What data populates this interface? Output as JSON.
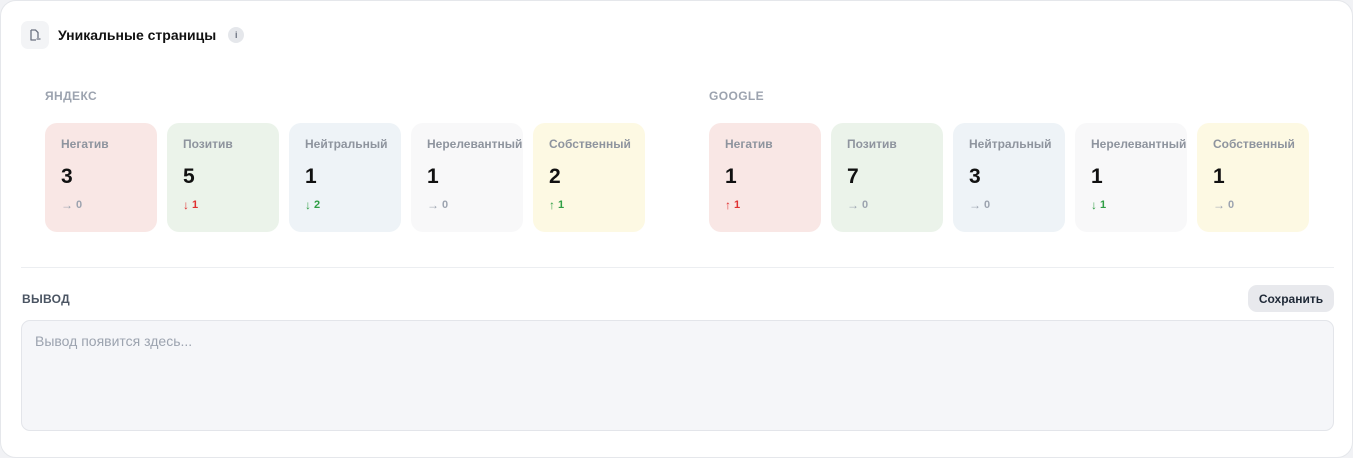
{
  "header": {
    "title": "Уникальные страницы",
    "info_icon": "i",
    "icon": "page-search-icon"
  },
  "colors": {
    "negative_bg": "#f9e7e5",
    "positive_bg": "#ebf3ea",
    "neutral_bg": "#eef3f7",
    "irrelevant_bg": "#f8f8f9",
    "own_bg": "#fdf9e3",
    "delta_up": "#2f9e44",
    "delta_down": "#e03131",
    "delta_neutral": "#9ca3af"
  },
  "engines": [
    {
      "label": "ЯНДЕКС",
      "cards": [
        {
          "label": "Негатив",
          "value": "3",
          "arrow": "→",
          "delta": "0",
          "tone": "neutral",
          "bg": "negative"
        },
        {
          "label": "Позитив",
          "value": "5",
          "arrow": "↓",
          "delta": "1",
          "tone": "down",
          "bg": "positive"
        },
        {
          "label": "Нейтральный",
          "value": "1",
          "arrow": "↓",
          "delta": "2",
          "tone": "up",
          "bg": "neutral"
        },
        {
          "label": "Нерелевантный",
          "value": "1",
          "arrow": "→",
          "delta": "0",
          "tone": "neutral",
          "bg": "irrelevant"
        },
        {
          "label": "Собственный",
          "value": "2",
          "arrow": "↑",
          "delta": "1",
          "tone": "up",
          "bg": "own"
        }
      ]
    },
    {
      "label": "GOOGLE",
      "cards": [
        {
          "label": "Негатив",
          "value": "1",
          "arrow": "↑",
          "delta": "1",
          "tone": "down",
          "bg": "negative"
        },
        {
          "label": "Позитив",
          "value": "7",
          "arrow": "→",
          "delta": "0",
          "tone": "neutral",
          "bg": "positive"
        },
        {
          "label": "Нейтральный",
          "value": "3",
          "arrow": "→",
          "delta": "0",
          "tone": "neutral",
          "bg": "neutral"
        },
        {
          "label": "Нерелевантный",
          "value": "1",
          "arrow": "↓",
          "delta": "1",
          "tone": "up",
          "bg": "irrelevant"
        },
        {
          "label": "Собственный",
          "value": "1",
          "arrow": "→",
          "delta": "0",
          "tone": "neutral",
          "bg": "own"
        }
      ]
    }
  ],
  "output": {
    "label": "ВЫВОД",
    "save_label": "Сохранить",
    "placeholder": "Вывод появится здесь...",
    "value": ""
  }
}
